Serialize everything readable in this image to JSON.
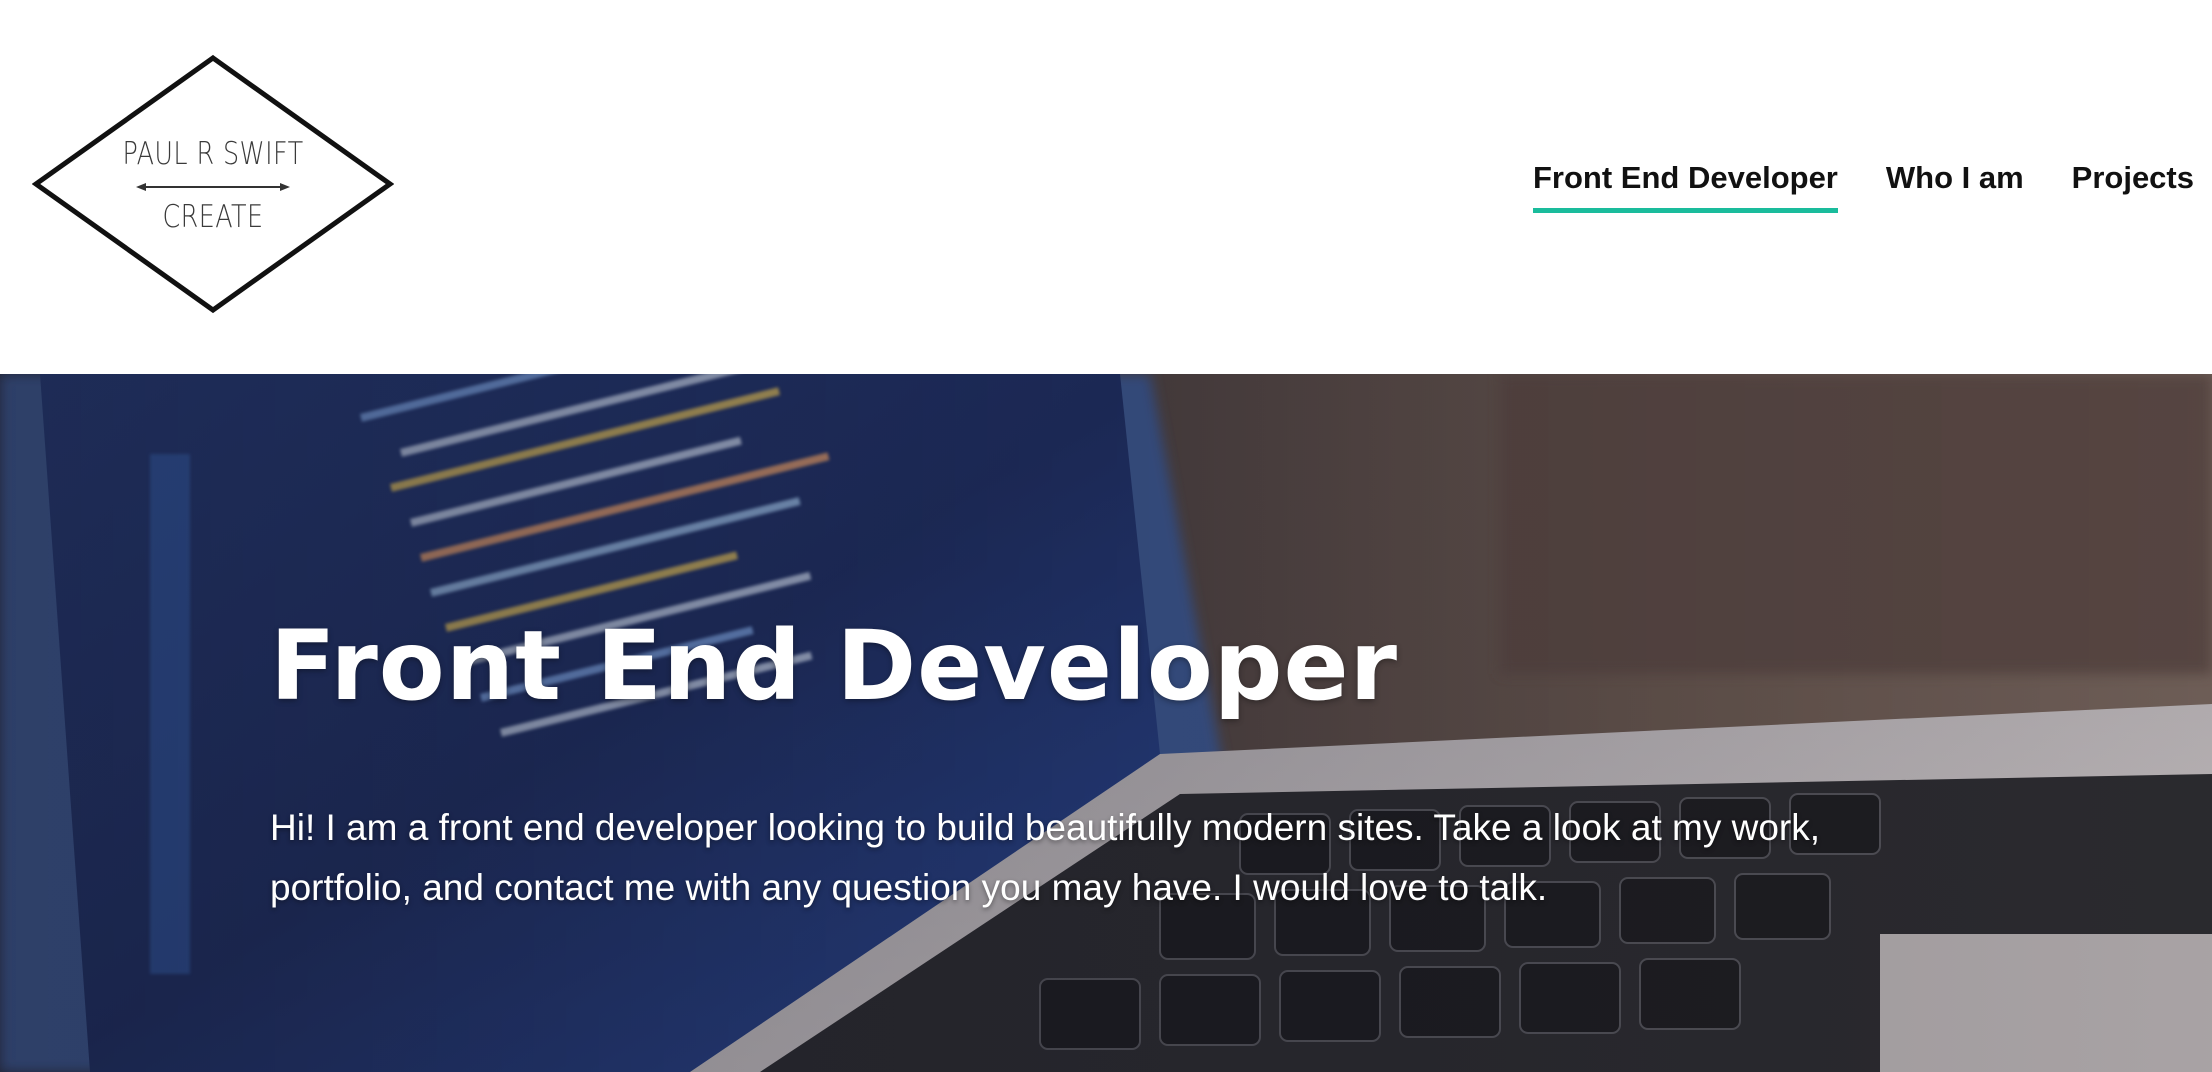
{
  "logo": {
    "line1": "PAUL R SWIFT",
    "line2": "CREATE"
  },
  "nav": {
    "items": [
      {
        "label": "Front End Developer",
        "active": true
      },
      {
        "label": "Who I am",
        "active": false
      },
      {
        "label": "Projects",
        "active": false
      }
    ]
  },
  "hero": {
    "title": "Front End Developer",
    "text": "Hi! I am a front end developer looking to build beautifully modern sites. Take a look at my work, portfolio, and contact me with any question you may have. I would love to talk."
  },
  "colors": {
    "accent": "#1abc9c",
    "nav_text": "#111111",
    "hero_text": "#ffffff"
  }
}
